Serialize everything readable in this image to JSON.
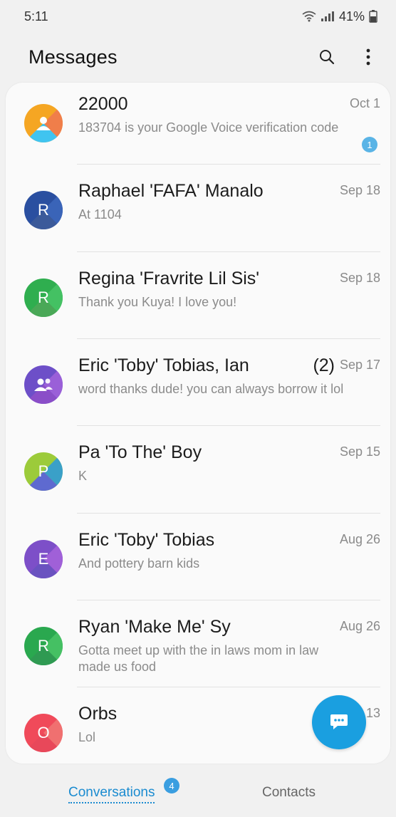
{
  "status_bar": {
    "time": "5:11",
    "battery": "41%"
  },
  "header": {
    "title": "Messages"
  },
  "conversations": [
    {
      "name": "22000",
      "date": "Oct 1",
      "snippet": "183704 is your Google Voice verification code",
      "unread": "1",
      "avatar_type": "person",
      "colors": [
        "#f5a623",
        "#f07e4a",
        "#40c4f0"
      ]
    },
    {
      "name": "Raphael 'FAFA' Manalo",
      "date": "Sep 18",
      "snippet": "At 1104",
      "avatar_letter": "R",
      "colors": [
        "#2a4fa0",
        "#3a64b8",
        "#3b5a9a"
      ]
    },
    {
      "name": "Regina 'Fravrite Lil Sis'",
      "date": "Sep 18",
      "snippet": "Thank you Kuya! I love you!",
      "avatar_letter": "R",
      "colors": [
        "#2fae4f",
        "#44c163",
        "#4aa857"
      ]
    },
    {
      "name": "Eric 'Toby' Tobias, Ian",
      "count": "(2)",
      "date": "Sep 17",
      "snippet": "word thanks dude! you can always borrow it lol",
      "avatar_type": "group",
      "colors": [
        "#6d4fc8",
        "#9a5fd8",
        "#8a4ec8"
      ]
    },
    {
      "name": "Pa 'To The' Boy",
      "date": "Sep 15",
      "snippet": "K",
      "avatar_letter": "P",
      "colors": [
        "#9ccb3a",
        "#3aa0c8",
        "#5e6ad0"
      ]
    },
    {
      "name": "Eric 'Toby' Tobias",
      "date": "Aug 26",
      "snippet": "And pottery barn kids",
      "avatar_letter": "E",
      "colors": [
        "#7d4fc8",
        "#a060d8",
        "#6a52c0"
      ]
    },
    {
      "name": "Ryan 'Make Me' Sy",
      "date": "Aug 26",
      "snippet": "Gotta meet up with the in laws mom in law made us food",
      "avatar_letter": "R",
      "colors": [
        "#2aa84f",
        "#45c063",
        "#2f9a52"
      ]
    },
    {
      "name": "Orbs",
      "date": "13",
      "snippet": "Lol",
      "avatar_letter": "O",
      "colors": [
        "#f04a5a",
        "#f07070",
        "#e8485a"
      ]
    }
  ],
  "bottom_nav": {
    "conversations_label": "Conversations",
    "conversations_badge": "4",
    "contacts_label": "Contacts"
  },
  "theme": {
    "accent": "#1a9fe0",
    "unread_badge": "#5ab4e6"
  }
}
